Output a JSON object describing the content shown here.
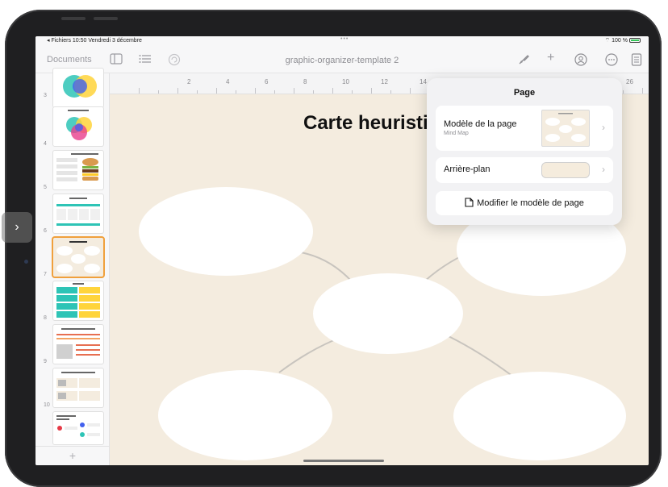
{
  "status_bar": {
    "left": "◂ Fichiers  10:50  Vendredi 3 décembre",
    "center": "•••",
    "right": "⌔ 100 %"
  },
  "toolbar": {
    "documents_label": "Documents",
    "document_title": "graphic-organizer-template 2",
    "icons": [
      "sidebar-icon",
      "list-icon",
      "undo-icon",
      "brush-icon",
      "plus-icon",
      "collaborate-icon",
      "more-icon",
      "document-icon"
    ]
  },
  "sidebar": {
    "thumb_numbers": [
      "3",
      "4",
      "5",
      "6",
      "7",
      "8",
      "9",
      "10",
      ""
    ],
    "selected_number": "7",
    "add_label": "+"
  },
  "ruler": {
    "labels": [
      "2",
      "4",
      "6",
      "8",
      "10",
      "12",
      "14",
      "26"
    ]
  },
  "slide": {
    "title": "Carte heuristique"
  },
  "popover": {
    "title": "Page",
    "template_label": "Modèle de la page",
    "template_sub": "Mind Map",
    "background_label": "Arrière-plan",
    "edit_button": "Modifier le modèle de page",
    "background_color": "#f5ecdd"
  },
  "colors": {
    "canvas": "#f4ecdf",
    "selection": "#f0a03c",
    "accent_teal": "#2ec4b6",
    "accent_yellow": "#ffd43b"
  }
}
